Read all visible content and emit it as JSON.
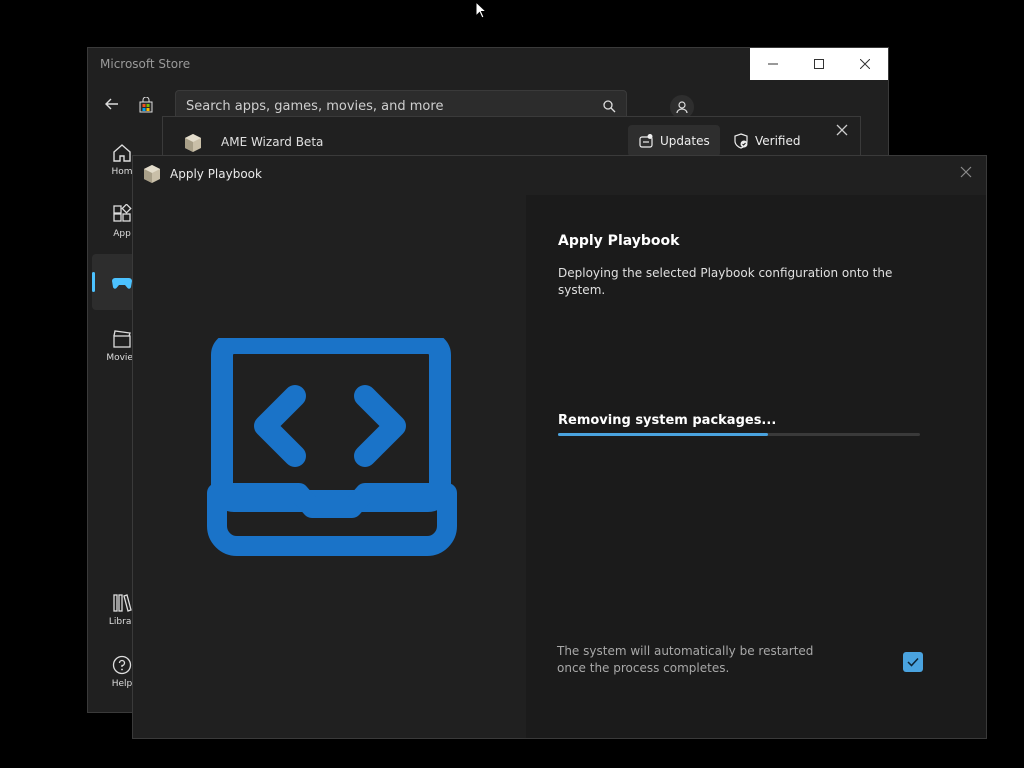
{
  "store": {
    "title": "Microsoft Store",
    "search_placeholder": "Search apps, games, movies, and more",
    "nav": [
      {
        "label": "Hom"
      },
      {
        "label": "App"
      },
      {
        "label": ""
      },
      {
        "label": "Movies"
      },
      {
        "label": "Librar"
      },
      {
        "label": "Help"
      }
    ],
    "product": {
      "name": "AME Wizard Beta",
      "updates_label": "Updates",
      "verified_label": "Verified"
    }
  },
  "dialog": {
    "title": "Apply Playbook",
    "heading": "Apply Playbook",
    "description": "Deploying the selected Playbook configuration onto the system.",
    "status": "Removing system packages...",
    "progress_fraction": 0.58,
    "restart_note": "The system will automatically be restarted once the process completes.",
    "restart_checked": true
  },
  "colors": {
    "accent": "#4aa3df",
    "illustration": "#1a73c8",
    "background": "#202020"
  }
}
